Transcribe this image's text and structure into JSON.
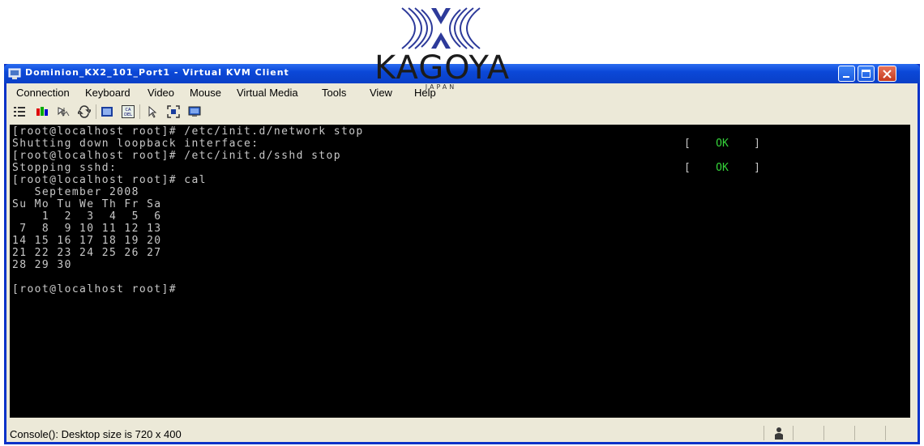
{
  "logo": {
    "name": "KAGOYA",
    "sub": "JAPAN"
  },
  "window": {
    "title": "Dominion_KX2_101_Port1 - Virtual KVM Client",
    "icon": "kvm-window-icon"
  },
  "menu": [
    "Connection",
    "Keyboard",
    "Video",
    "Mouse",
    "Virtual Media",
    "Tools",
    "View",
    "Help"
  ],
  "toolbar": {
    "icons": [
      "properties-icon",
      "video-settings-icon",
      "sync-mouse-icon",
      "refresh-icon",
      "fit-screen-icon",
      "ctrl-alt-del-icon",
      "single-cursor-icon",
      "fullscreen-icon",
      "screenshot-icon"
    ]
  },
  "console": {
    "lines": [
      "[root@localhost root]# /etc/init.d/network stop",
      "Shutting down loopback interface:",
      "[root@localhost root]# /etc/init.d/sshd stop",
      "Stopping sshd:",
      "[root@localhost root]# cal",
      "   September 2008",
      "Su Mo Tu We Th Fr Sa",
      "    1  2  3  4  5  6",
      " 7  8  9 10 11 12 13",
      "14 15 16 17 18 19 20",
      "21 22 23 24 25 26 27",
      "28 29 30",
      "",
      "[root@localhost root]#"
    ],
    "status_ok": {
      "open": "[",
      "text": "OK",
      "close": "]"
    }
  },
  "statusbar": {
    "text": "Console(): Desktop size is 720 x 400",
    "icon": "user-icon"
  }
}
